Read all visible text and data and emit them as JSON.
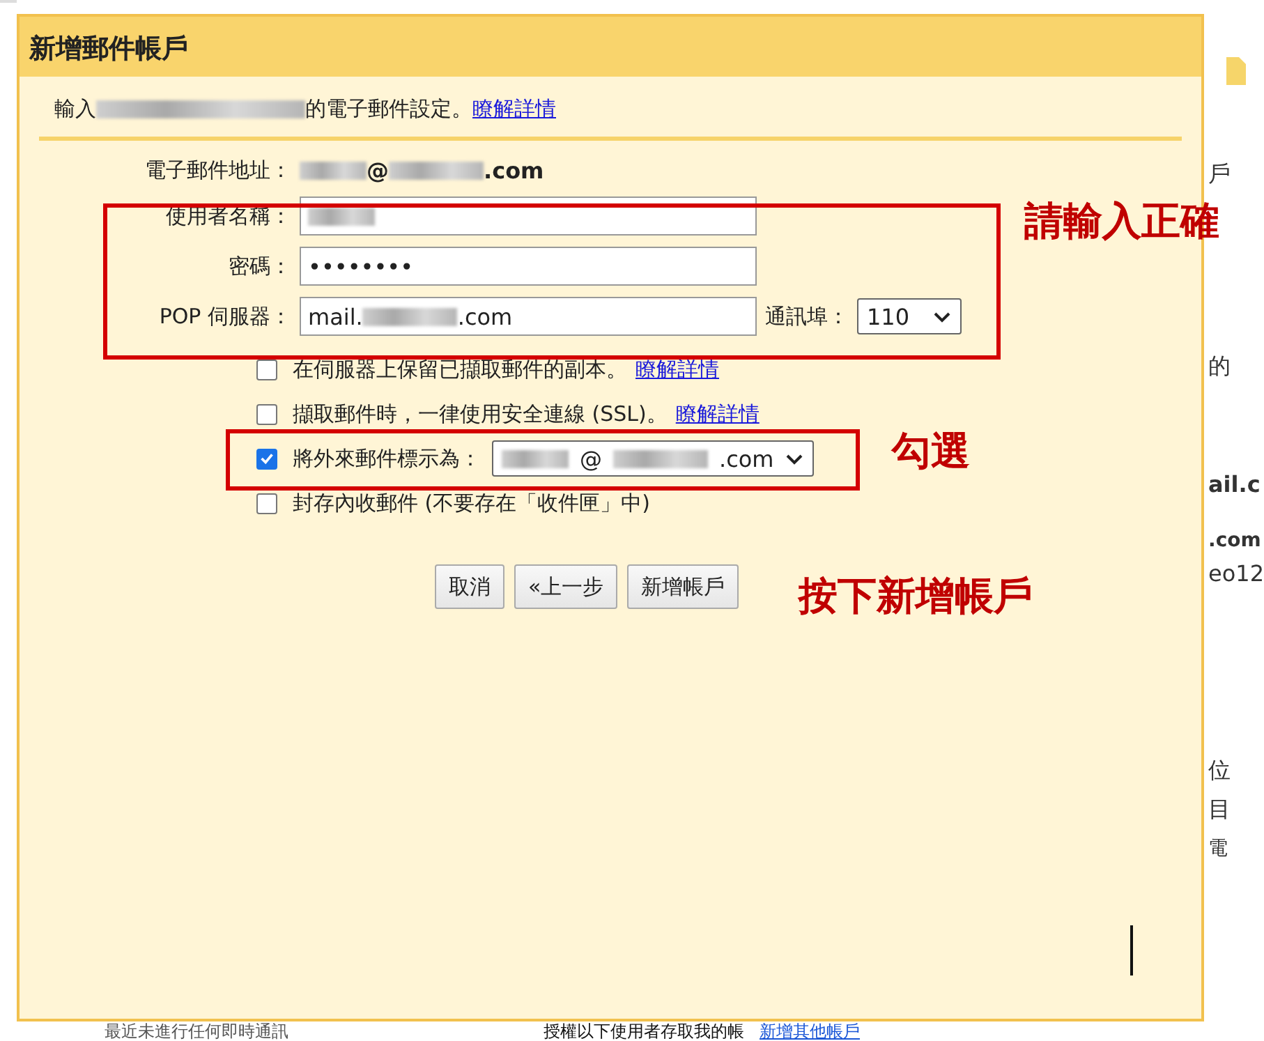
{
  "background_page": {
    "right_fragments": [
      "戶",
      "的",
      "ail.c",
      ".com",
      "eo12",
      "位",
      "目",
      "電"
    ],
    "bottom_left": "最近未進行任何即時通訊",
    "bottom_right": "授權以下使用者存取我的帳",
    "bottom_link": "新增其他帳戶"
  },
  "dialog": {
    "title": "新增郵件帳戶",
    "intro": [
      {
        "kind": "text",
        "text": "輸入"
      },
      {
        "kind": "redacted"
      },
      {
        "kind": "text",
        "text": "的電子郵件設定。"
      },
      {
        "kind": "link",
        "text": "瞭解詳情"
      }
    ],
    "email": {
      "label": "電子郵件地址：",
      "value": [
        {
          "kind": "redacted"
        },
        {
          "kind": "text",
          "text": "@"
        },
        {
          "kind": "redacted"
        },
        {
          "kind": "text",
          "text": ".com"
        }
      ]
    },
    "fields": [
      {
        "label": "使用者名稱：",
        "value": [
          {
            "kind": "redacted"
          }
        ]
      },
      {
        "label": "密碼：",
        "value": [
          {
            "kind": "text",
            "text": "••••••••"
          }
        ]
      },
      {
        "label": "POP 伺服器：",
        "value": [
          {
            "kind": "text",
            "text": "mail."
          },
          {
            "kind": "redacted"
          },
          {
            "kind": "text",
            "text": ".com"
          }
        ]
      }
    ],
    "port": {
      "label": "通訊埠：",
      "value": "110"
    },
    "options": [
      {
        "kind": "plain",
        "checked": false,
        "text": "在伺服器上保留已擷取郵件的副本。",
        "link": "瞭解詳情"
      },
      {
        "kind": "plain",
        "checked": false,
        "text": "擷取郵件時，一律使用安全連線 (SSL)。",
        "link": "瞭解詳情"
      },
      {
        "kind": "select",
        "checked": true,
        "text": "將外來郵件標示為：",
        "value": [
          {
            "kind": "redacted"
          },
          {
            "kind": "text",
            "text": "@"
          },
          {
            "kind": "redacted"
          },
          {
            "kind": "text",
            "text": ".com"
          }
        ]
      },
      {
        "kind": "plain",
        "checked": false,
        "text": "封存內收郵件 (不要存在「收件匣」中)"
      }
    ],
    "buttons": [
      "取消",
      "«上一步",
      "新增帳戶"
    ]
  },
  "annotations": [
    "請輸入正確",
    "勾選",
    "按下新增帳戶"
  ]
}
